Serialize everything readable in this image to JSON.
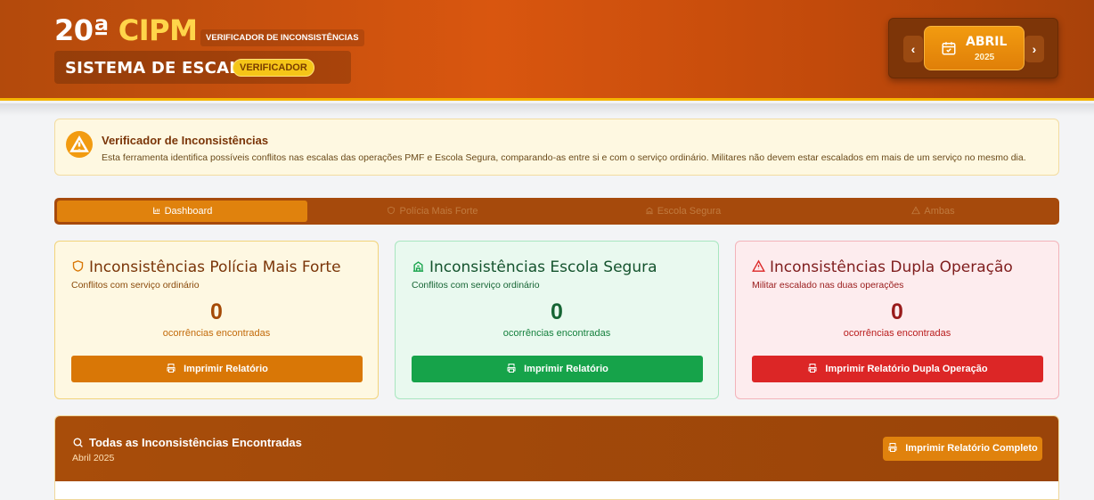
{
  "header": {
    "brand_prefix": "20ª",
    "brand_highlight": "CIPM",
    "brand_subtitle": "VERIFICADOR DE INCONSISTÊNCIAS",
    "system_title": "SISTEMA DE ESCALA",
    "system_badge": "VERIFICADOR",
    "month": "ABRIL",
    "year": "2025",
    "prev_symbol": "‹",
    "next_symbol": "›"
  },
  "info": {
    "title": "Verificador de Inconsistências",
    "description": "Esta ferramenta identifica possíveis conflitos nas escalas das operações PMF e Escola Segura, comparando-as entre si e com o serviço ordinário. Militares não devem estar escalados em mais de um serviço no mesmo dia."
  },
  "tabs": [
    {
      "label": "Dashboard",
      "icon": "bar-chart-icon",
      "active": true
    },
    {
      "label": "Polícia Mais Forte",
      "icon": "shield-icon",
      "active": false
    },
    {
      "label": "Escola Segura",
      "icon": "school-icon",
      "active": false
    },
    {
      "label": "Ambas",
      "icon": "warning-icon",
      "active": false
    }
  ],
  "cards": [
    {
      "title": "Inconsistências Polícia Mais Forte",
      "subtitle": "Conflitos com serviço ordinário",
      "count": "0",
      "count_label": "ocorrências encontradas",
      "button": "Imprimir Relatório",
      "icon": "shield-icon",
      "color": "#d97706"
    },
    {
      "title": "Inconsistências Escola Segura",
      "subtitle": "Conflitos com serviço ordinário",
      "count": "0",
      "count_label": "ocorrências encontradas",
      "button": "Imprimir Relatório",
      "icon": "school-icon",
      "color": "#16a34a"
    },
    {
      "title": "Inconsistências Dupla Operação",
      "subtitle": "Militar escalado nas duas operações",
      "count": "0",
      "count_label": "ocorrências encontradas",
      "button": "Imprimir Relatório Dupla Operação",
      "icon": "warning-icon",
      "color": "#dc2626"
    }
  ],
  "panel": {
    "title": "Todas as Inconsistências Encontradas",
    "subtitle": "Abril 2025",
    "button": "Imprimir Relatório Completo"
  }
}
